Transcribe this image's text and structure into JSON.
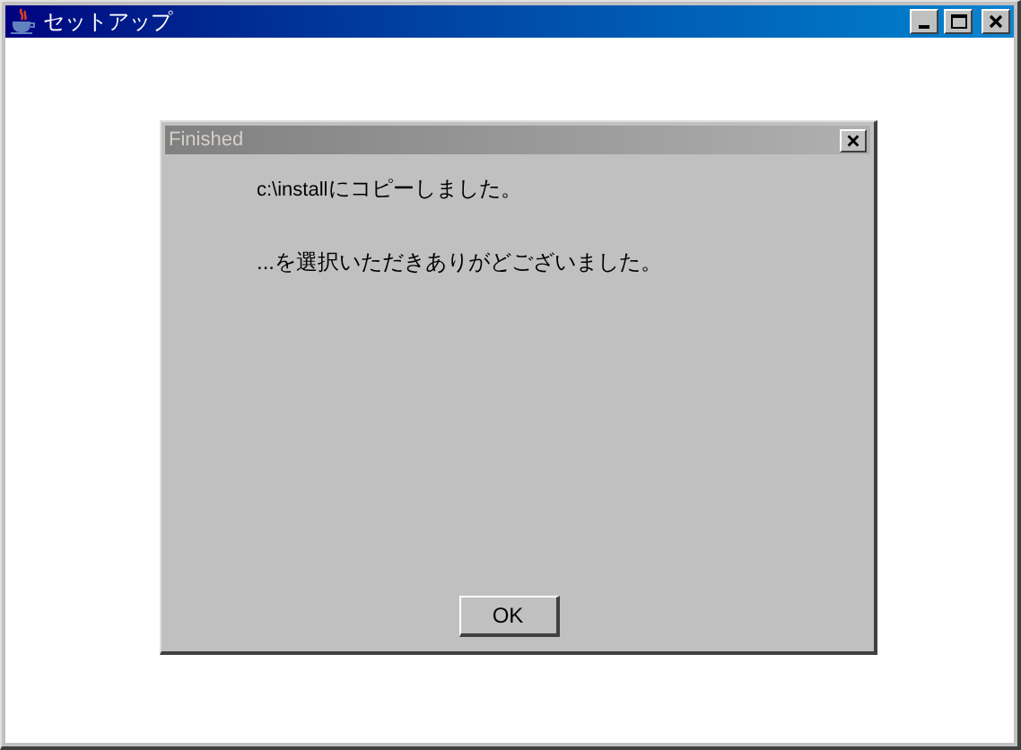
{
  "window": {
    "title": "セットアップ"
  },
  "dialog": {
    "title": "Finished",
    "messages": [
      {
        "path": "c:\\install",
        "text": "にコピーしました。"
      },
      {
        "text": "...を選択いただきありがどございました。"
      }
    ],
    "buttons": [
      "OK"
    ]
  }
}
